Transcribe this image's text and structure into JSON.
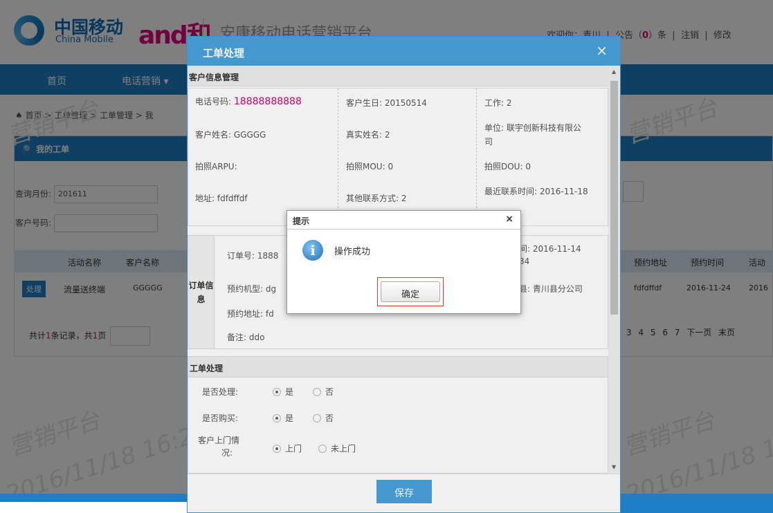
{
  "header": {
    "cm_cn": "中国移动",
    "cm_en": "China Mobile",
    "and_logo": "and和",
    "platform": "安康移动电话营销平台",
    "welcome": "欢迎你：青川",
    "notice_prefix": "公告（",
    "notice_count": "0",
    "notice_suffix": "）条",
    "logout": "注销",
    "modify": "修改"
  },
  "nav": {
    "home": "首页",
    "tele": "电话营销 ▾"
  },
  "breadcrumb": "首页 > 工单管理 > 工单管理 > 我",
  "panel": {
    "title": "我的工单"
  },
  "query": {
    "month_label": "查询月份:",
    "month_value": "201611",
    "cust_label": "客户号码:"
  },
  "table": {
    "headers": [
      "活动名称",
      "客户名称",
      "预约地址",
      "预约时间",
      "活动"
    ],
    "row": {
      "action": "处理",
      "activity": "流量送终端",
      "cust": "GGGGG",
      "addr": "fdfdffdf",
      "time": "2016-11-24",
      "act": "2016"
    }
  },
  "pagination": {
    "prefix": "共计",
    "count": "1",
    "mid": "条记录，共",
    "pages": "1",
    "suffix": "页",
    "links": "3  4  5  6  7  下一页  末页"
  },
  "watermarks": {
    "text1": "营销平台",
    "text2": "2016/11/18 16:29"
  },
  "modal": {
    "title": "工单处理",
    "close": "×",
    "cust_section": "客户信息管理",
    "phone_label": "电话号码:",
    "phone_value": "18888888888",
    "birthday": "客户生日: 20150514",
    "job": "工作: 2",
    "name": "客户姓名: GGGGG",
    "realname": "真实姓名: 2",
    "unit": "单位: 联宇创新科技有限公",
    "unit2": "司",
    "arpu": "拍照ARPU:",
    "mou": "拍照MOU: 0",
    "dou": "拍照DOU: 0",
    "addr": "地址: fdfdffdf",
    "other": "其他联系方式: 2",
    "last": "最近联系时间: 2016-11-18",
    "order_label": "订单信息",
    "order_no": "订单号: 1888",
    "order_time": "间: 2016-11-14",
    "order_time2": "34",
    "model": "预约机型: dg",
    "county": "县: 青川县分公司",
    "appt_addr": "预约地址: fd",
    "note": "备注: ddo",
    "proc_section": "工单处理",
    "q1": "是否处理:",
    "q2": "是否购买:",
    "q3": "客户上门情",
    "q3b": "况:",
    "yes": "是",
    "no": "否",
    "visit": "上门",
    "novisit": "未上门",
    "save": "保存"
  },
  "alert": {
    "title": "提示",
    "close": "×",
    "message": "操作成功",
    "ok": "确定"
  }
}
